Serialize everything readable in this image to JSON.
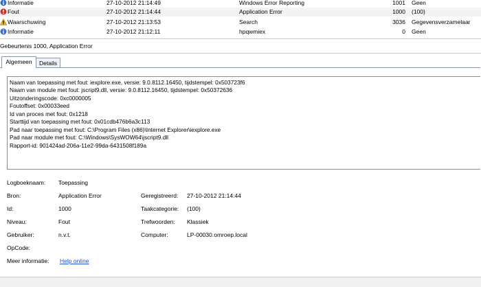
{
  "events": [
    {
      "level": "Informatie",
      "icon": "info-icon",
      "timestamp": "27-10-2012 21:14:49",
      "source": "Windows Error Reporting",
      "event_id": "1001",
      "category": "Geen"
    },
    {
      "level": "Fout",
      "icon": "error-icon",
      "timestamp": "27-10-2012 21:14:44",
      "source": "Application Error",
      "event_id": "1000",
      "category": "(100)"
    },
    {
      "level": "Waarschuwing",
      "icon": "warning-icon",
      "timestamp": "27-10-2012 21:13:53",
      "source": "Search",
      "event_id": "3036",
      "category": "Gegevensverzamelaar"
    },
    {
      "level": "Informatie",
      "icon": "info-icon",
      "timestamp": "27-10-2012 21:12:11",
      "source": "hpqwmiex",
      "event_id": "0",
      "category": "Geen"
    }
  ],
  "detail": {
    "title": "Gebeurtenis 1000, Application Error",
    "tabs": [
      "Algemeen",
      "Details"
    ],
    "description": [
      "Naam van toepassing met fout: iexplore.exe, versie: 9.0.8112.16450, tijdstempel: 0x503723f6",
      "Naam van module met fout: jscript9.dll, versie: 9.0.8112.16450, tijdstempel: 0x50372636",
      "Uitzonderingscode: 0xc0000005",
      "Foutoffset: 0x00033eed",
      "Id van proces met fout: 0x1218",
      "Starttijd van toepassing met fout: 0x01cdb476b6a3c113",
      "Pad naar toepassing met fout: C:\\Program Files (x86)\\Internet Explorer\\iexplore.exe",
      "Pad naar module met fout: C:\\Windows\\SysWOW64\\jscript9.dll",
      "Rapport-id: 901424ad-206a-11e2-99da-6431508f189a"
    ],
    "props": {
      "logboeknaam": {
        "label": "Logboeknaam:",
        "value": "Toepassing"
      },
      "bron": {
        "label": "Bron:",
        "value": "Application Error"
      },
      "geregistreerd": {
        "label": "Geregistreerd:",
        "value": "27-10-2012 21:14:44"
      },
      "id": {
        "label": "Id:",
        "value": "1000"
      },
      "taakcategorie": {
        "label": "Taakcategorie:",
        "value": "(100)"
      },
      "niveau": {
        "label": "Niveau:",
        "value": "Fout"
      },
      "trefwoorden": {
        "label": "Trefwoorden:",
        "value": "Klassiek"
      },
      "gebruiker": {
        "label": "Gebruiker:",
        "value": "n.v.t."
      },
      "computer": {
        "label": "Computer:",
        "value": "LP-00030.omroep.local"
      },
      "opcode": {
        "label": "OpCode:",
        "value": ""
      },
      "meer_informatie": {
        "label": "Meer informatie:",
        "value": "Help online"
      }
    }
  },
  "colors": {
    "info": "#3b6fc4",
    "error": "#c8332a",
    "warning": "#e8b923",
    "link": "#1c52c9"
  }
}
